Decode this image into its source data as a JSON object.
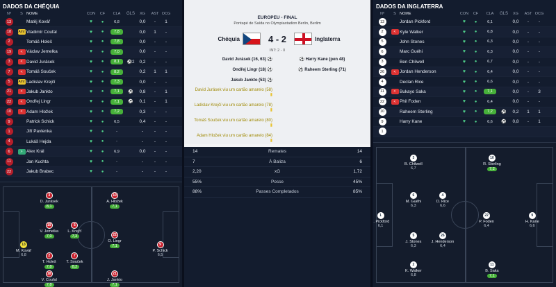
{
  "left": {
    "title": "DADOS DA CHÉQUIA",
    "headers": [
      "Nº",
      "S",
      "NOME",
      "CON",
      "CF",
      "CLA",
      "GLS",
      "XG",
      "AST",
      "OCG"
    ],
    "rows": [
      {
        "num": "13",
        "name": "Matěj Kovář",
        "rating": "6,8",
        "g": false,
        "xg": "0,0",
        "ast": "-",
        "ocg": "1"
      },
      {
        "num": "18",
        "s": "Amr",
        "name": "Vladimír Coufal",
        "rating": "7,8",
        "g": true,
        "xg": "0,0",
        "ast": "1",
        "ocg": "-"
      },
      {
        "num": "2",
        "name": "Tomáš Holeš",
        "rating": "7,8",
        "g": true,
        "xg": "0,0",
        "ast": "-",
        "ocg": "-"
      },
      {
        "num": "19",
        "s": "<",
        "name": "Václav Jemelka",
        "rating": "7,0",
        "g": true,
        "xg": "0,0",
        "ast": "-",
        "ocg": "-"
      },
      {
        "num": "3",
        "s": "<",
        "name": "David Jurásek",
        "rating": "8,1",
        "g": true,
        "ev": "⚽2",
        "xg": "0,2",
        "ast": "-",
        "ocg": "-"
      },
      {
        "num": "7",
        "s": "<",
        "name": "Tomáš Souček",
        "rating": "8,2",
        "g": true,
        "xg": "0,2",
        "ast": "1",
        "ocg": "1"
      },
      {
        "num": "5",
        "s": "Amr",
        "name": "Ladislav Krejčí",
        "rating": "7,3",
        "g": true,
        "xg": "0,0",
        "ast": "-",
        "ocg": "-"
      },
      {
        "num": "21",
        "s": "<",
        "name": "Jakub Jankto",
        "rating": "7,1",
        "g": true,
        "ev": "⚽",
        "xg": "0,8",
        "ast": "-",
        "ocg": "1"
      },
      {
        "num": "22",
        "s": "<",
        "name": "Ondřej Lingr",
        "rating": "7,1",
        "g": true,
        "ev": "⚽",
        "xg": "0,1",
        "ast": "-",
        "ocg": "1"
      },
      {
        "num": "10",
        "s": "<",
        "name": "Adam Hložek",
        "rating": "7,2",
        "g": true,
        "xg": "0,3",
        "ast": "-",
        "ocg": "-"
      },
      {
        "num": "9",
        "name": "Patrick Schick",
        "rating": "6,5",
        "g": false,
        "xg": "0,4",
        "ast": "-",
        "ocg": "-"
      },
      {
        "num": "1",
        "name": "Jiří Pavlenka",
        "rating": "-",
        "g": false,
        "xg": "-",
        "ast": "-",
        "ocg": "-"
      },
      {
        "num": "4",
        "name": "Lukáš Hejda",
        "rating": "-",
        "g": false,
        "xg": "-",
        "ast": "-",
        "ocg": "-"
      },
      {
        "num": "6",
        "s": ">",
        "name": "Alex Král",
        "rating": "6,9",
        "g": false,
        "xg": "0,0",
        "ast": "-",
        "ocg": "-"
      },
      {
        "num": "11",
        "name": "Jan Kuchta",
        "rating": "-",
        "g": false,
        "xg": "-",
        "ast": "-",
        "ocg": "-"
      },
      {
        "num": "22",
        "name": "Jakub Brabec",
        "rating": "-",
        "g": false,
        "xg": "-",
        "ast": "-",
        "ocg": "-"
      }
    ]
  },
  "right": {
    "title": "DADOS DA INGLATERRA",
    "headers": [
      "Nº",
      "S",
      "NOME",
      "CON",
      "CF",
      "CLA",
      "GLS",
      "XG",
      "AST",
      "OCG"
    ],
    "rows": [
      {
        "num": "13",
        "name": "Jordan Pickford",
        "rating": "6,1",
        "g": false,
        "xg": "0,0",
        "ast": "-",
        "ocg": "-"
      },
      {
        "num": "2",
        "s": "<",
        "name": "Kyle Walker",
        "rating": "6,8",
        "g": false,
        "xg": "0,0",
        "ast": "-",
        "ocg": "-"
      },
      {
        "num": "5",
        "name": "John Stones",
        "rating": "6,3",
        "g": false,
        "xg": "0,0",
        "ast": "-",
        "ocg": "-"
      },
      {
        "num": "6",
        "name": "Marc Guéhi",
        "rating": "6,3",
        "g": false,
        "xg": "0,0",
        "ast": "-",
        "ocg": "-"
      },
      {
        "num": "3",
        "name": "Ben Chilwell",
        "rating": "6,7",
        "g": false,
        "xg": "0,0",
        "ast": "-",
        "ocg": "-"
      },
      {
        "num": "26",
        "s": "<",
        "name": "Jordan Henderson",
        "rating": "6,4",
        "g": false,
        "xg": "0,0",
        "ast": "-",
        "ocg": "-"
      },
      {
        "num": "4",
        "name": "Declan Rice",
        "rating": "6,6",
        "g": false,
        "xg": "0,0",
        "ast": "-",
        "ocg": "-"
      },
      {
        "num": "11",
        "s": "<",
        "name": "Bukayo Saka",
        "rating": "7,1",
        "g": true,
        "xg": "0,0",
        "ast": "-",
        "ocg": "3"
      },
      {
        "num": "22",
        "s": "<",
        "name": "Phil Foden",
        "rating": "6,4",
        "g": false,
        "xg": "0,0",
        "ast": "-",
        "ocg": "-"
      },
      {
        "num": "10",
        "name": "Raheem Sterling",
        "rating": "7,2",
        "g": true,
        "ev": "⚽",
        "xg": "0,2",
        "ast": "1",
        "ocg": "1"
      },
      {
        "num": "9",
        "name": "Harry Kane",
        "rating": "6,6",
        "g": false,
        "ev": "⚽",
        "xg": "0,8",
        "ast": "-",
        "ocg": "1"
      },
      {
        "num": "1",
        "name": "",
        "rating": "",
        "g": false,
        "xg": "",
        "ast": "",
        "ocg": ""
      }
    ]
  },
  "match": {
    "competition": "EUROPEU - FINAL",
    "venue": "Pontapé de Saída no Olympiastadion Berlin, Berlim",
    "home": "Chéquia",
    "away": "Inglaterra",
    "score": "4 - 2",
    "interval": "INT: 2 - 0",
    "home_events": [
      "David Jurásek (16, 63)",
      "Ondřej Lingr (18)",
      "Jakub Jankto (53)"
    ],
    "home_cards": [
      "David Jurásek viu um cartão amarelo (58)",
      "Ladislav Krejčí viu um cartão amarelo (78)",
      "Tomáš Souček viu um cartão amarelo (80)",
      "Adam Hložek viu um cartão amarelo (84)"
    ],
    "away_events": [
      "Harry Kane (pen 48)",
      "Raheem Sterling (71)"
    ],
    "stats": [
      {
        "a": "14",
        "label": "Remates",
        "b": "14"
      },
      {
        "a": "7",
        "label": "À Baliza",
        "b": "6"
      },
      {
        "a": "2,20",
        "label": "xG",
        "b": "1,72"
      },
      {
        "a": "55%",
        "label": "Posse",
        "b": "45%"
      },
      {
        "a": "88%",
        "label": "Passes Completados",
        "b": "85%"
      }
    ]
  },
  "left_pitch": [
    {
      "n": "3",
      "name": "D. Jurásek",
      "r": "8,1",
      "g": true,
      "c": "r"
    },
    {
      "n": "10",
      "name": "A. Hložek",
      "r": "7,1",
      "g": true,
      "c": "r"
    },
    {
      "n": "19",
      "name": "V. Jemelka",
      "r": "7,0",
      "g": true,
      "c": "r"
    },
    {
      "n": "5",
      "name": "L. Krejčí",
      "r": "7,3",
      "g": true,
      "c": "r"
    },
    {
      "n": "13",
      "name": "M. Kovář",
      "r": "6,8",
      "g": false,
      "c": "y"
    },
    {
      "n": "22",
      "name": "O. Lingr",
      "r": "7,1",
      "g": true,
      "c": "r"
    },
    {
      "n": "9",
      "name": "P. Schick",
      "r": "6,5",
      "g": false,
      "c": "r"
    },
    {
      "n": "2",
      "name": "T. Holeš",
      "r": "7,8",
      "g": true,
      "c": "r"
    },
    {
      "n": "7",
      "name": "T. Souček",
      "r": "8,2",
      "g": true,
      "c": "r"
    },
    {
      "n": "18",
      "name": "V. Coufal",
      "r": "7,8",
      "g": true,
      "c": "r"
    },
    {
      "n": "21",
      "name": "J. Jankto",
      "r": "7,1",
      "g": true,
      "c": "r"
    }
  ],
  "right_pitch": [
    {
      "n": "3",
      "name": "B. Chilwell",
      "r": "6,7",
      "g": false,
      "c": "w"
    },
    {
      "n": "10",
      "name": "R. Sterling",
      "r": "7,2",
      "g": true,
      "c": "w"
    },
    {
      "n": "6",
      "name": "M. Guéhi",
      "r": "6,3",
      "g": false,
      "c": "w"
    },
    {
      "n": "4",
      "name": "D. Rice",
      "r": "6,6",
      "g": false,
      "c": "w"
    },
    {
      "n": "1",
      "name": "J. Pickford",
      "r": "6,1",
      "g": false,
      "c": "w"
    },
    {
      "n": "22",
      "name": "P. Foden",
      "r": "6,4",
      "g": false,
      "c": "w"
    },
    {
      "n": "9",
      "name": "H. Kane",
      "r": "6,6",
      "g": false,
      "c": "w"
    },
    {
      "n": "5",
      "name": "J. Stones",
      "r": "6,3",
      "g": false,
      "c": "w"
    },
    {
      "n": "26",
      "name": "J. Henderson",
      "r": "6,4",
      "g": false,
      "c": "w"
    },
    {
      "n": "2",
      "name": "K. Walker",
      "r": "6,8",
      "g": false,
      "c": "w"
    },
    {
      "n": "11",
      "name": "B. Saka",
      "r": "7,1",
      "g": true,
      "c": "w"
    }
  ]
}
